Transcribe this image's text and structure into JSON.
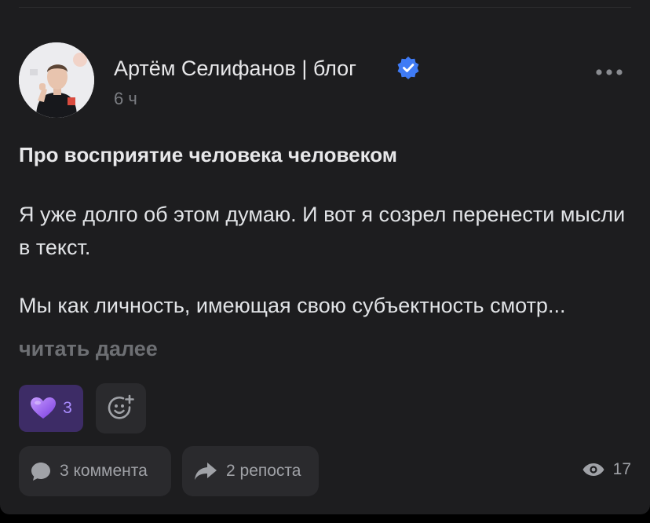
{
  "author": {
    "name": "Артём Селифанов | блог",
    "time": "6 ч"
  },
  "post": {
    "title": "Про восприятие человека человеком",
    "paragraph1": "Я уже долго об этом думаю. И вот я созрел перенести мысли в текст.",
    "paragraph2": "Мы как личность, имеющая свою субъектность смотр...",
    "read_more": "читать далее"
  },
  "reactions": {
    "count": "3"
  },
  "footer": {
    "comments": "3 коммента",
    "reposts": "2 репоста",
    "views": "17"
  },
  "colors": {
    "background": "#1d1d1f",
    "accent_verified": "#3f7bf5",
    "reaction_bg": "#3d2c66",
    "reaction_text": "#a98cff"
  },
  "icons": [
    "verified-icon",
    "more-icon",
    "heart-icon",
    "add-reaction-icon",
    "comment-icon",
    "repost-icon",
    "eye-icon"
  ]
}
